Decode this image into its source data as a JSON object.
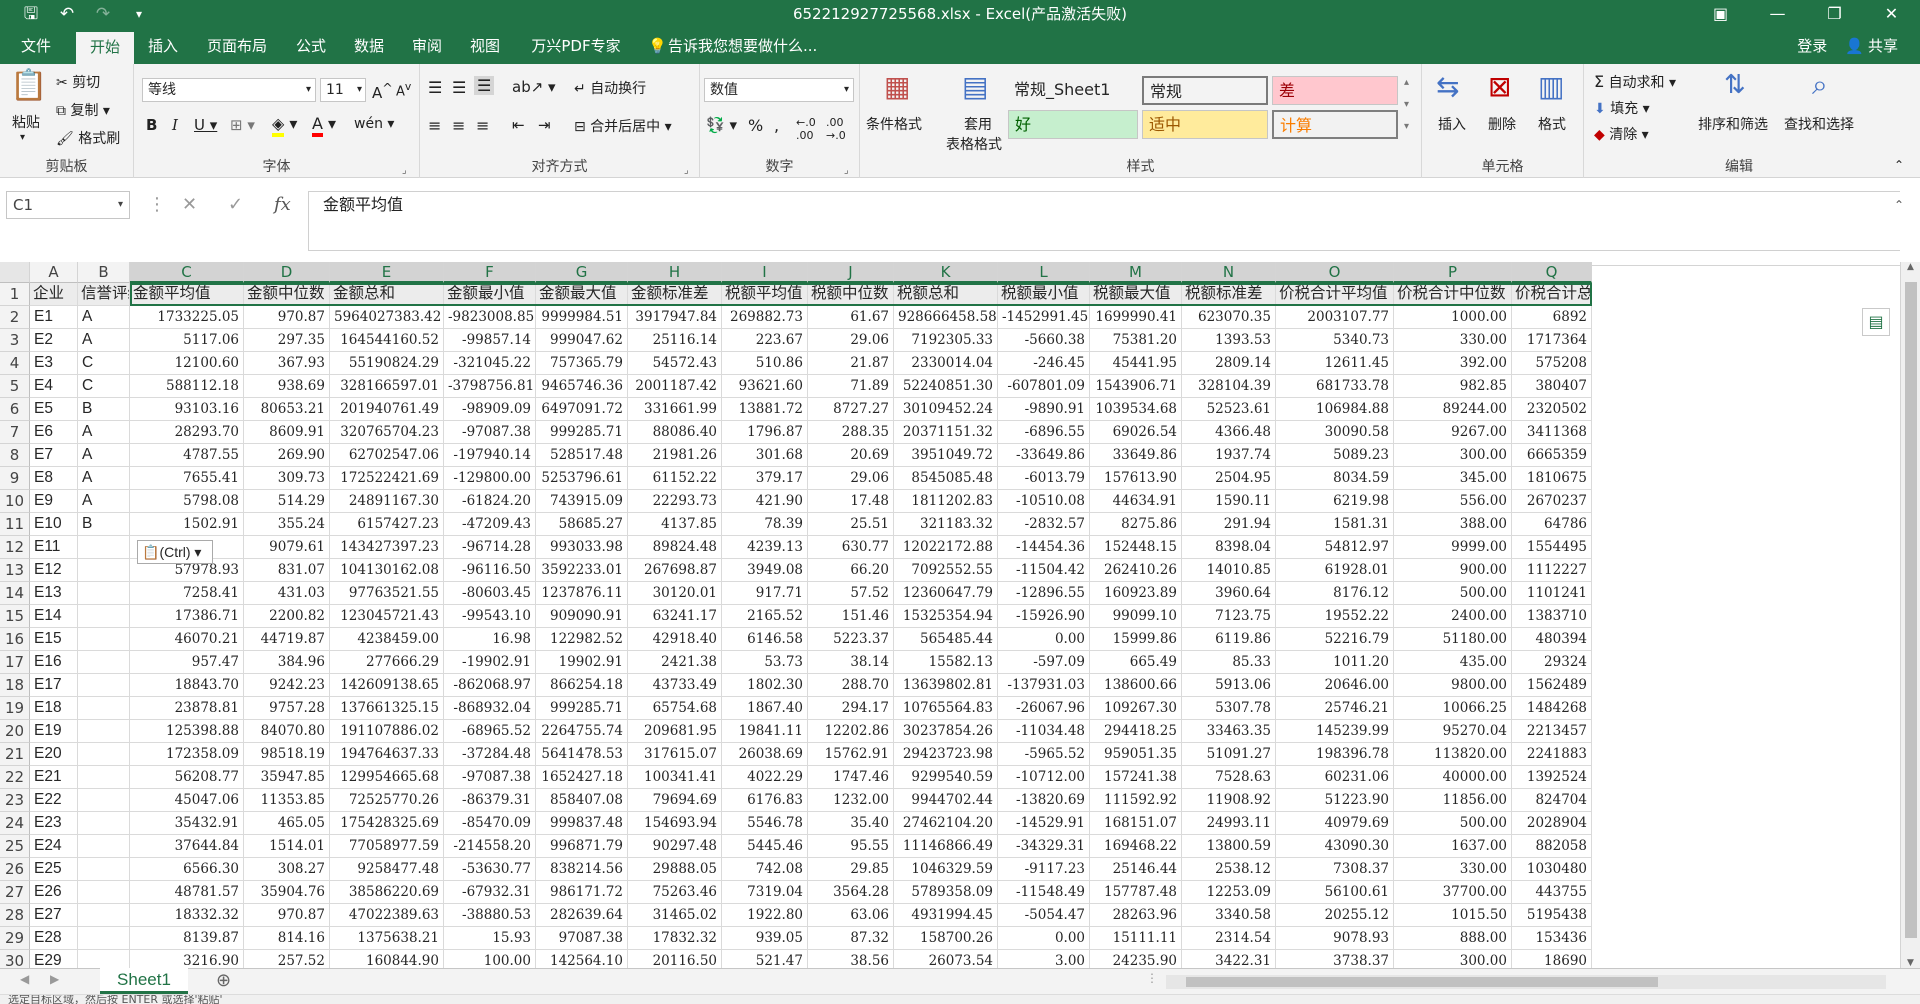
{
  "window": {
    "title": "652212927725568.xlsx - Excel(产品激活失败)"
  },
  "tabs": [
    {
      "label": "文件"
    },
    {
      "label": "开始"
    },
    {
      "label": "插入"
    },
    {
      "label": "页面布局"
    },
    {
      "label": "公式"
    },
    {
      "label": "数据"
    },
    {
      "label": "审阅"
    },
    {
      "label": "视图"
    },
    {
      "label": "万兴PDF专家"
    },
    {
      "label": "告诉我您想要做什么..."
    }
  ],
  "account": {
    "login": "登录",
    "share": "共享"
  },
  "ribbon": {
    "clipboard": {
      "paste": "粘贴",
      "cut": "剪切",
      "copy": "复制",
      "painter": "格式刷",
      "group": "剪贴板"
    },
    "font": {
      "name": "等线",
      "size": "11",
      "group": "字体"
    },
    "alignment": {
      "wrap": "自动换行",
      "merge": "合并后居中",
      "group": "对齐方式"
    },
    "number": {
      "format": "数值",
      "group": "数字"
    },
    "styles": {
      "conditional": "条件格式",
      "table_line1": "套用",
      "table_line2": "表格格式",
      "group": "样式",
      "cells": [
        {
          "label": "常规_Sheet1",
          "bg": "#ffffff",
          "fg": "#000000"
        },
        {
          "label": "常规",
          "bg": "#ffffff",
          "fg": "#000000"
        },
        {
          "label": "差",
          "bg": "#ffc7ce",
          "fg": "#9c0006"
        },
        {
          "label": "好",
          "bg": "#c6efce",
          "fg": "#006100"
        },
        {
          "label": "适中",
          "bg": "#ffeb9c",
          "fg": "#9c5700"
        },
        {
          "label": "计算",
          "bg": "#f2f2f2",
          "fg": "#fa7d00"
        }
      ]
    },
    "cells": {
      "insert": "插入",
      "delete": "删除",
      "format": "格式",
      "group": "单元格"
    },
    "editing": {
      "autosum": "自动求和",
      "fill": "填充",
      "clear": "清除",
      "sort": "排序和筛选",
      "find": "查找和选择",
      "group": "编辑"
    }
  },
  "formula_bar": {
    "name_box": "C1",
    "content": "金额平均值"
  },
  "colors": {
    "accent": "#217346",
    "header_row_bg": "#ececec"
  },
  "sheet": {
    "columns": [
      "A",
      "B",
      "C",
      "D",
      "E",
      "F",
      "G",
      "H",
      "I",
      "J",
      "K",
      "L",
      "M",
      "N",
      "O",
      "P",
      "Q"
    ],
    "header": [
      "企业",
      "信誉评级",
      "金额平均值",
      "金额中位数",
      "金额总和",
      "金额最小值",
      "金额最大值",
      "金额标准差",
      "税额平均值",
      "税额中位数",
      "税额总和",
      "税额最小值",
      "税额最大值",
      "税额标准差",
      "价税合计平均值",
      "价税合计中位数",
      "价税合计总和"
    ],
    "rows": [
      [
        "E1",
        "A",
        "1733225.05",
        "970.87",
        "5964027383.42",
        "-9823008.85",
        "9999984.51",
        "3917947.84",
        "269882.73",
        "61.67",
        "928666458.58",
        "-1452991.45",
        "1699990.41",
        "623070.35",
        "2003107.77",
        "1000.00",
        "6892"
      ],
      [
        "E2",
        "A",
        "5117.06",
        "297.35",
        "164544160.52",
        "-99857.14",
        "999047.62",
        "25116.14",
        "223.67",
        "29.06",
        "7192305.33",
        "-5660.38",
        "75381.20",
        "1393.53",
        "5340.73",
        "330.00",
        "1717364"
      ],
      [
        "E3",
        "C",
        "12100.60",
        "367.93",
        "55190824.29",
        "-321045.22",
        "757365.79",
        "54572.43",
        "510.86",
        "21.87",
        "2330014.04",
        "-246.45",
        "45441.95",
        "2809.14",
        "12611.45",
        "392.00",
        "575208"
      ],
      [
        "E4",
        "C",
        "588112.18",
        "938.69",
        "328166597.01",
        "-3798756.81",
        "9465746.36",
        "2001187.42",
        "93621.60",
        "71.89",
        "52240851.30",
        "-607801.09",
        "1543906.71",
        "328104.39",
        "681733.78",
        "982.85",
        "380407"
      ],
      [
        "E5",
        "B",
        "93103.16",
        "80653.21",
        "201940761.49",
        "-98909.09",
        "6497091.72",
        "331661.99",
        "13881.72",
        "8727.27",
        "30109452.24",
        "-9890.91",
        "1039534.68",
        "52523.61",
        "106984.88",
        "89244.00",
        "2320502"
      ],
      [
        "E6",
        "A",
        "28293.70",
        "8609.91",
        "320765704.23",
        "-97087.38",
        "999285.71",
        "88086.40",
        "1796.87",
        "288.35",
        "20371151.32",
        "-6896.55",
        "69026.54",
        "4366.48",
        "30090.58",
        "9267.00",
        "3411368"
      ],
      [
        "E7",
        "A",
        "4787.55",
        "269.90",
        "62702547.06",
        "-197940.14",
        "528517.48",
        "21981.26",
        "301.68",
        "20.69",
        "3951049.72",
        "-33649.86",
        "33649.86",
        "1937.74",
        "5089.23",
        "300.00",
        "6665359"
      ],
      [
        "E8",
        "A",
        "7655.41",
        "309.73",
        "172522421.69",
        "-129800.00",
        "5253796.61",
        "61152.22",
        "379.17",
        "29.06",
        "8545085.48",
        "-6013.79",
        "157613.90",
        "2504.95",
        "8034.59",
        "345.00",
        "1810675"
      ],
      [
        "E9",
        "A",
        "5798.08",
        "514.29",
        "24891167.30",
        "-61824.20",
        "743915.09",
        "22293.73",
        "421.90",
        "17.48",
        "1811202.83",
        "-10510.08",
        "44634.91",
        "1590.11",
        "6219.98",
        "556.00",
        "2670237"
      ],
      [
        "E10",
        "B",
        "1502.91",
        "355.24",
        "6157427.23",
        "-47209.43",
        "58685.27",
        "4137.85",
        "78.39",
        "25.51",
        "321183.32",
        "-2832.57",
        "8275.86",
        "291.94",
        "1581.31",
        "388.00",
        "64786"
      ],
      [
        "E11",
        "",
        "",
        "9079.61",
        "143427397.23",
        "-96714.28",
        "993033.98",
        "89824.48",
        "4239.13",
        "630.77",
        "12022172.88",
        "-14454.36",
        "152448.15",
        "8398.04",
        "54812.97",
        "9999.00",
        "1554495"
      ],
      [
        "E12",
        "",
        "57978.93",
        "831.07",
        "104130162.08",
        "-96116.50",
        "3592233.01",
        "267698.87",
        "3949.08",
        "66.20",
        "7092552.55",
        "-11504.42",
        "262410.26",
        "14010.85",
        "61928.01",
        "900.00",
        "1112227"
      ],
      [
        "E13",
        "",
        "7258.41",
        "431.03",
        "97763521.55",
        "-80603.45",
        "1237876.11",
        "30120.01",
        "917.71",
        "57.52",
        "12360647.79",
        "-12896.55",
        "160923.89",
        "3960.64",
        "8176.12",
        "500.00",
        "1101241"
      ],
      [
        "E14",
        "",
        "17386.71",
        "2200.82",
        "123045721.43",
        "-99543.10",
        "909090.91",
        "63241.17",
        "2165.52",
        "151.46",
        "15325354.94",
        "-15926.90",
        "99099.10",
        "7123.75",
        "19552.22",
        "2400.00",
        "1383710"
      ],
      [
        "E15",
        "",
        "46070.21",
        "44719.87",
        "4238459.00",
        "16.98",
        "122982.52",
        "42918.40",
        "6146.58",
        "5223.37",
        "565485.44",
        "0.00",
        "15999.86",
        "6119.86",
        "52216.79",
        "51180.00",
        "480394"
      ],
      [
        "E16",
        "",
        "957.47",
        "384.96",
        "277666.29",
        "-19902.91",
        "19902.91",
        "2421.38",
        "53.73",
        "38.14",
        "15582.13",
        "-597.09",
        "665.49",
        "85.33",
        "1011.20",
        "435.00",
        "29324"
      ],
      [
        "E17",
        "",
        "18843.70",
        "9242.23",
        "142609138.65",
        "-862068.97",
        "866254.18",
        "43733.49",
        "1802.30",
        "288.70",
        "13639802.81",
        "-137931.03",
        "138600.66",
        "5913.06",
        "20646.00",
        "9800.00",
        "1562489"
      ],
      [
        "E18",
        "",
        "23878.81",
        "9757.28",
        "137661325.15",
        "-868932.04",
        "999285.71",
        "65754.68",
        "1867.40",
        "294.17",
        "10765564.83",
        "-26067.96",
        "109267.30",
        "5307.78",
        "25746.21",
        "10066.25",
        "1484268"
      ],
      [
        "E19",
        "",
        "125398.88",
        "84070.80",
        "191107886.02",
        "-68965.52",
        "2264755.74",
        "209681.95",
        "19841.11",
        "12202.86",
        "30237854.26",
        "-11034.48",
        "294418.25",
        "33463.35",
        "145239.99",
        "95270.04",
        "2213457"
      ],
      [
        "E20",
        "",
        "172358.09",
        "98518.19",
        "194764637.33",
        "-37284.48",
        "5641478.53",
        "317615.07",
        "26038.69",
        "15762.91",
        "29423723.98",
        "-5965.52",
        "959051.35",
        "51091.27",
        "198396.78",
        "113820.00",
        "2241883"
      ],
      [
        "E21",
        "",
        "56208.77",
        "35947.85",
        "129954665.68",
        "-97087.38",
        "1652427.18",
        "100341.41",
        "4022.29",
        "1747.46",
        "9299540.59",
        "-10712.00",
        "157241.38",
        "7528.63",
        "60231.06",
        "40000.00",
        "1392524"
      ],
      [
        "E22",
        "",
        "45047.06",
        "11353.85",
        "72525770.26",
        "-86379.31",
        "858407.08",
        "79694.69",
        "6176.83",
        "1232.00",
        "9944702.44",
        "-13820.69",
        "111592.92",
        "11908.92",
        "51223.90",
        "11856.00",
        "824704"
      ],
      [
        "E23",
        "",
        "35432.91",
        "465.05",
        "175428325.69",
        "-85470.09",
        "999837.48",
        "154693.94",
        "5546.78",
        "35.40",
        "27462104.20",
        "-14529.91",
        "168151.07",
        "24993.11",
        "40979.69",
        "500.00",
        "2028904"
      ],
      [
        "E24",
        "",
        "37644.84",
        "1514.01",
        "77058977.59",
        "-214558.20",
        "996871.79",
        "90297.48",
        "5445.46",
        "95.55",
        "11146866.49",
        "-34329.31",
        "169468.22",
        "13800.59",
        "43090.30",
        "1637.00",
        "882058"
      ],
      [
        "E25",
        "",
        "6566.30",
        "308.27",
        "9258477.48",
        "-53630.77",
        "838214.56",
        "29888.05",
        "742.08",
        "29.85",
        "1046329.59",
        "-9117.23",
        "25146.44",
        "2538.12",
        "7308.37",
        "330.00",
        "1030480"
      ],
      [
        "E26",
        "",
        "48781.57",
        "35904.76",
        "38586220.69",
        "-67932.31",
        "986171.72",
        "75263.46",
        "7319.04",
        "3564.28",
        "5789358.09",
        "-11548.49",
        "157787.48",
        "12253.09",
        "56100.61",
        "37700.00",
        "443755"
      ],
      [
        "E27",
        "",
        "18332.32",
        "970.87",
        "47022389.63",
        "-38880.53",
        "282639.64",
        "31465.02",
        "1922.80",
        "63.06",
        "4931994.45",
        "-5054.47",
        "28263.96",
        "3340.58",
        "20255.12",
        "1015.50",
        "5195438"
      ],
      [
        "E28",
        "",
        "8139.87",
        "814.16",
        "1375638.21",
        "15.93",
        "97087.38",
        "17832.32",
        "939.05",
        "87.32",
        "158700.26",
        "0.00",
        "15111.11",
        "2314.54",
        "9078.93",
        "888.00",
        "153436"
      ],
      [
        "E29",
        "",
        "3216.90",
        "257.52",
        "160844.90",
        "100.00",
        "142564.10",
        "20116.50",
        "521.47",
        "38.56",
        "26073.54",
        "3.00",
        "24235.90",
        "3422.31",
        "3738.37",
        "300.00",
        "18690"
      ]
    ]
  },
  "paste_options": {
    "label": "(Ctrl)"
  },
  "sheet_tabs": [
    {
      "label": "Sheet1"
    }
  ],
  "status": {
    "text": "选定目标区域，然后按 ENTER 或选择'粘贴'"
  }
}
